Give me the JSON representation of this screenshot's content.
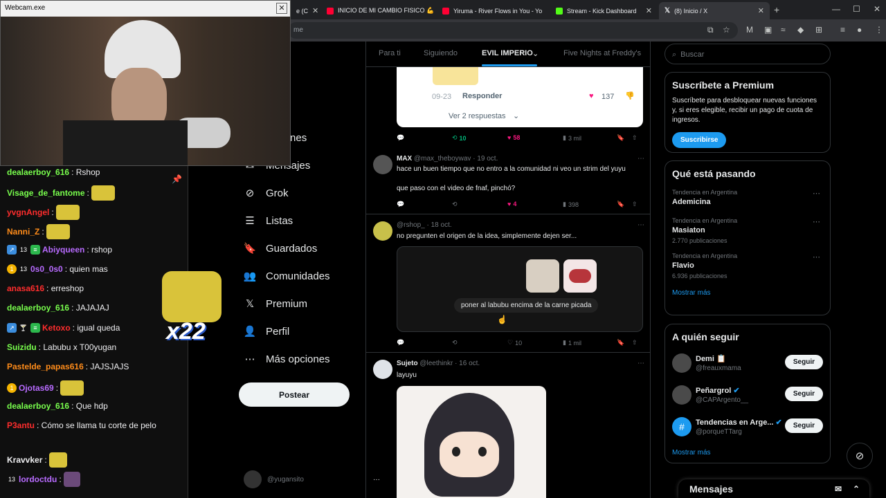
{
  "browser": {
    "tabs": [
      {
        "label": "e (C",
        "left": 0
      },
      {
        "label": "INICIO DE MI CAMBIO FISICO 💪",
        "color": "#ff0033"
      },
      {
        "label": "Yiruma - River Flows in You - Yo",
        "color": "#ff0033"
      },
      {
        "label": "Stream - Kick Dashboard",
        "color": "#53fc18"
      },
      {
        "label": "(8) Inicio / X",
        "color": "#ffffff"
      }
    ],
    "url_fragment": "me"
  },
  "webcam": {
    "title": "Webcam.exe"
  },
  "chat": {
    "messages": [
      {
        "user": "dealaerboy_616",
        "text": ": Rshop",
        "color": "#79ff4d"
      },
      {
        "user": "Visage_de_fantome",
        "text": ":",
        "color": "#79ff4d"
      },
      {
        "user": "yvgnAngel",
        "text": ":",
        "color": "#ff2d2d"
      },
      {
        "user": "Nanni_Z",
        "text": ":",
        "color": "#ff8c1a"
      },
      {
        "user": "Abiyqueen",
        "text": ": rshop",
        "color": "#b86bff"
      },
      {
        "user": "0s0_0s0",
        "text": ": quien mas",
        "color": "#b86bff"
      },
      {
        "user": "anasa616",
        "text": ": erreshop",
        "color": "#ff2d2d"
      },
      {
        "user": "dealaerboy_616",
        "text": ": JAJAJAJ",
        "color": "#79ff4d"
      },
      {
        "user": "Ketoxo",
        "text": ": igual queda",
        "color": "#ff2d2d"
      },
      {
        "user": "Suizidu",
        "text": ": Labubu x T00yugan",
        "color": "#79ff4d"
      },
      {
        "user": "Pastelde_papas616",
        "text": ": JAJSJAJS",
        "color": "#ff8c1a"
      },
      {
        "user": "Ojotas69",
        "text": ":",
        "color": "#b86bff"
      },
      {
        "user": "dealaerboy_616",
        "text": ": Que hdp",
        "color": "#79ff4d"
      },
      {
        "user": "P3antu",
        "text": ": Cómo se llama tu corte de pelo",
        "color": "#ff2d2d"
      },
      {
        "user": "Kravvker",
        "text": ":",
        "color": "#efeff1"
      },
      {
        "user": "lordoctdu",
        "text": ":",
        "color": "#b86bff"
      }
    ],
    "combo": "x22"
  },
  "nav": {
    "items": [
      {
        "label": "rar",
        "icon": "explore-icon"
      },
      {
        "label": "caciones",
        "icon": "bell-icon"
      },
      {
        "label": "Mensajes",
        "icon": "mail-icon"
      },
      {
        "label": "Grok",
        "icon": "grok-icon"
      },
      {
        "label": "Listas",
        "icon": "list-icon"
      },
      {
        "label": "Guardados",
        "icon": "bookmark-icon"
      },
      {
        "label": "Comunidades",
        "icon": "communities-icon"
      },
      {
        "label": "Premium",
        "icon": "x-icon"
      },
      {
        "label": "Perfil",
        "icon": "profile-icon"
      },
      {
        "label": "Más opciones",
        "icon": "more-icon"
      }
    ],
    "post": "Postear",
    "handle": "@yugansito"
  },
  "timeline": {
    "tabs": [
      "Para ti",
      "Siguiendo",
      "EVIL IMPERIO",
      "Five Nights at Freddy's"
    ],
    "reply_card": {
      "date": "09-23",
      "reply": "Responder",
      "likes": "137",
      "more": "Ver 2 respuestas"
    },
    "first_actions": {
      "reposts": "10",
      "likes": "58",
      "views": "3 mil"
    },
    "tweets": [
      {
        "name": "MAX",
        "handle": "@max_theboywav",
        "date": "· 19 oct.",
        "text1": "hace un buen tiempo que no entro a la comunidad ni veo un strim del yuyu",
        "text2": "que paso con el video de fnaf, pinchó?",
        "likes": "4",
        "views": "398"
      },
      {
        "name": "",
        "handle": "@rshop_",
        "date": "· 18 oct.",
        "text1": "no pregunten el origen de la idea, simplemente dejen ser...",
        "text2": "",
        "caption": "poner al labubu encima de la carne picada",
        "likes": "10",
        "views": "1 mil"
      },
      {
        "name": "Sujeto",
        "handle": "@leethinkr",
        "date": "· 16 oct.",
        "text1": "layuyu",
        "text2": ""
      }
    ]
  },
  "right": {
    "search_placeholder": "Buscar",
    "premium": {
      "title": "Suscríbete a Premium",
      "text": "Suscríbete para desbloquear nuevas funciones y, si eres elegible, recibir un pago de cuota de ingresos.",
      "button": "Suscribirse"
    },
    "trends": {
      "title": "Qué está pasando",
      "items": [
        {
          "context": "Tendencia en Argentina",
          "name": "Ademicina",
          "count": ""
        },
        {
          "context": "Tendencia en Argentina",
          "name": "Masiaton",
          "count": "2.770 publicaciones"
        },
        {
          "context": "Tendencia en Argentina",
          "name": "Flavio",
          "count": "6.936 publicaciones"
        }
      ],
      "more": "Mostrar más"
    },
    "follow": {
      "title": "A quién seguir",
      "items": [
        {
          "name": "Demi 📋",
          "handle": "@freauxmama",
          "button": "Seguir"
        },
        {
          "name": "Peñargrol",
          "handle": "@CAPArgento__",
          "button": "Seguir"
        },
        {
          "name": "Tendencias en Arge...",
          "handle": "@porqueTTarg",
          "button": "Seguir"
        }
      ],
      "more": "Mostrar más"
    },
    "messages": "Mensajes"
  },
  "colors": {
    "accent": "#1d9bf0",
    "like": "#f91880",
    "repost": "#00ba7c"
  }
}
